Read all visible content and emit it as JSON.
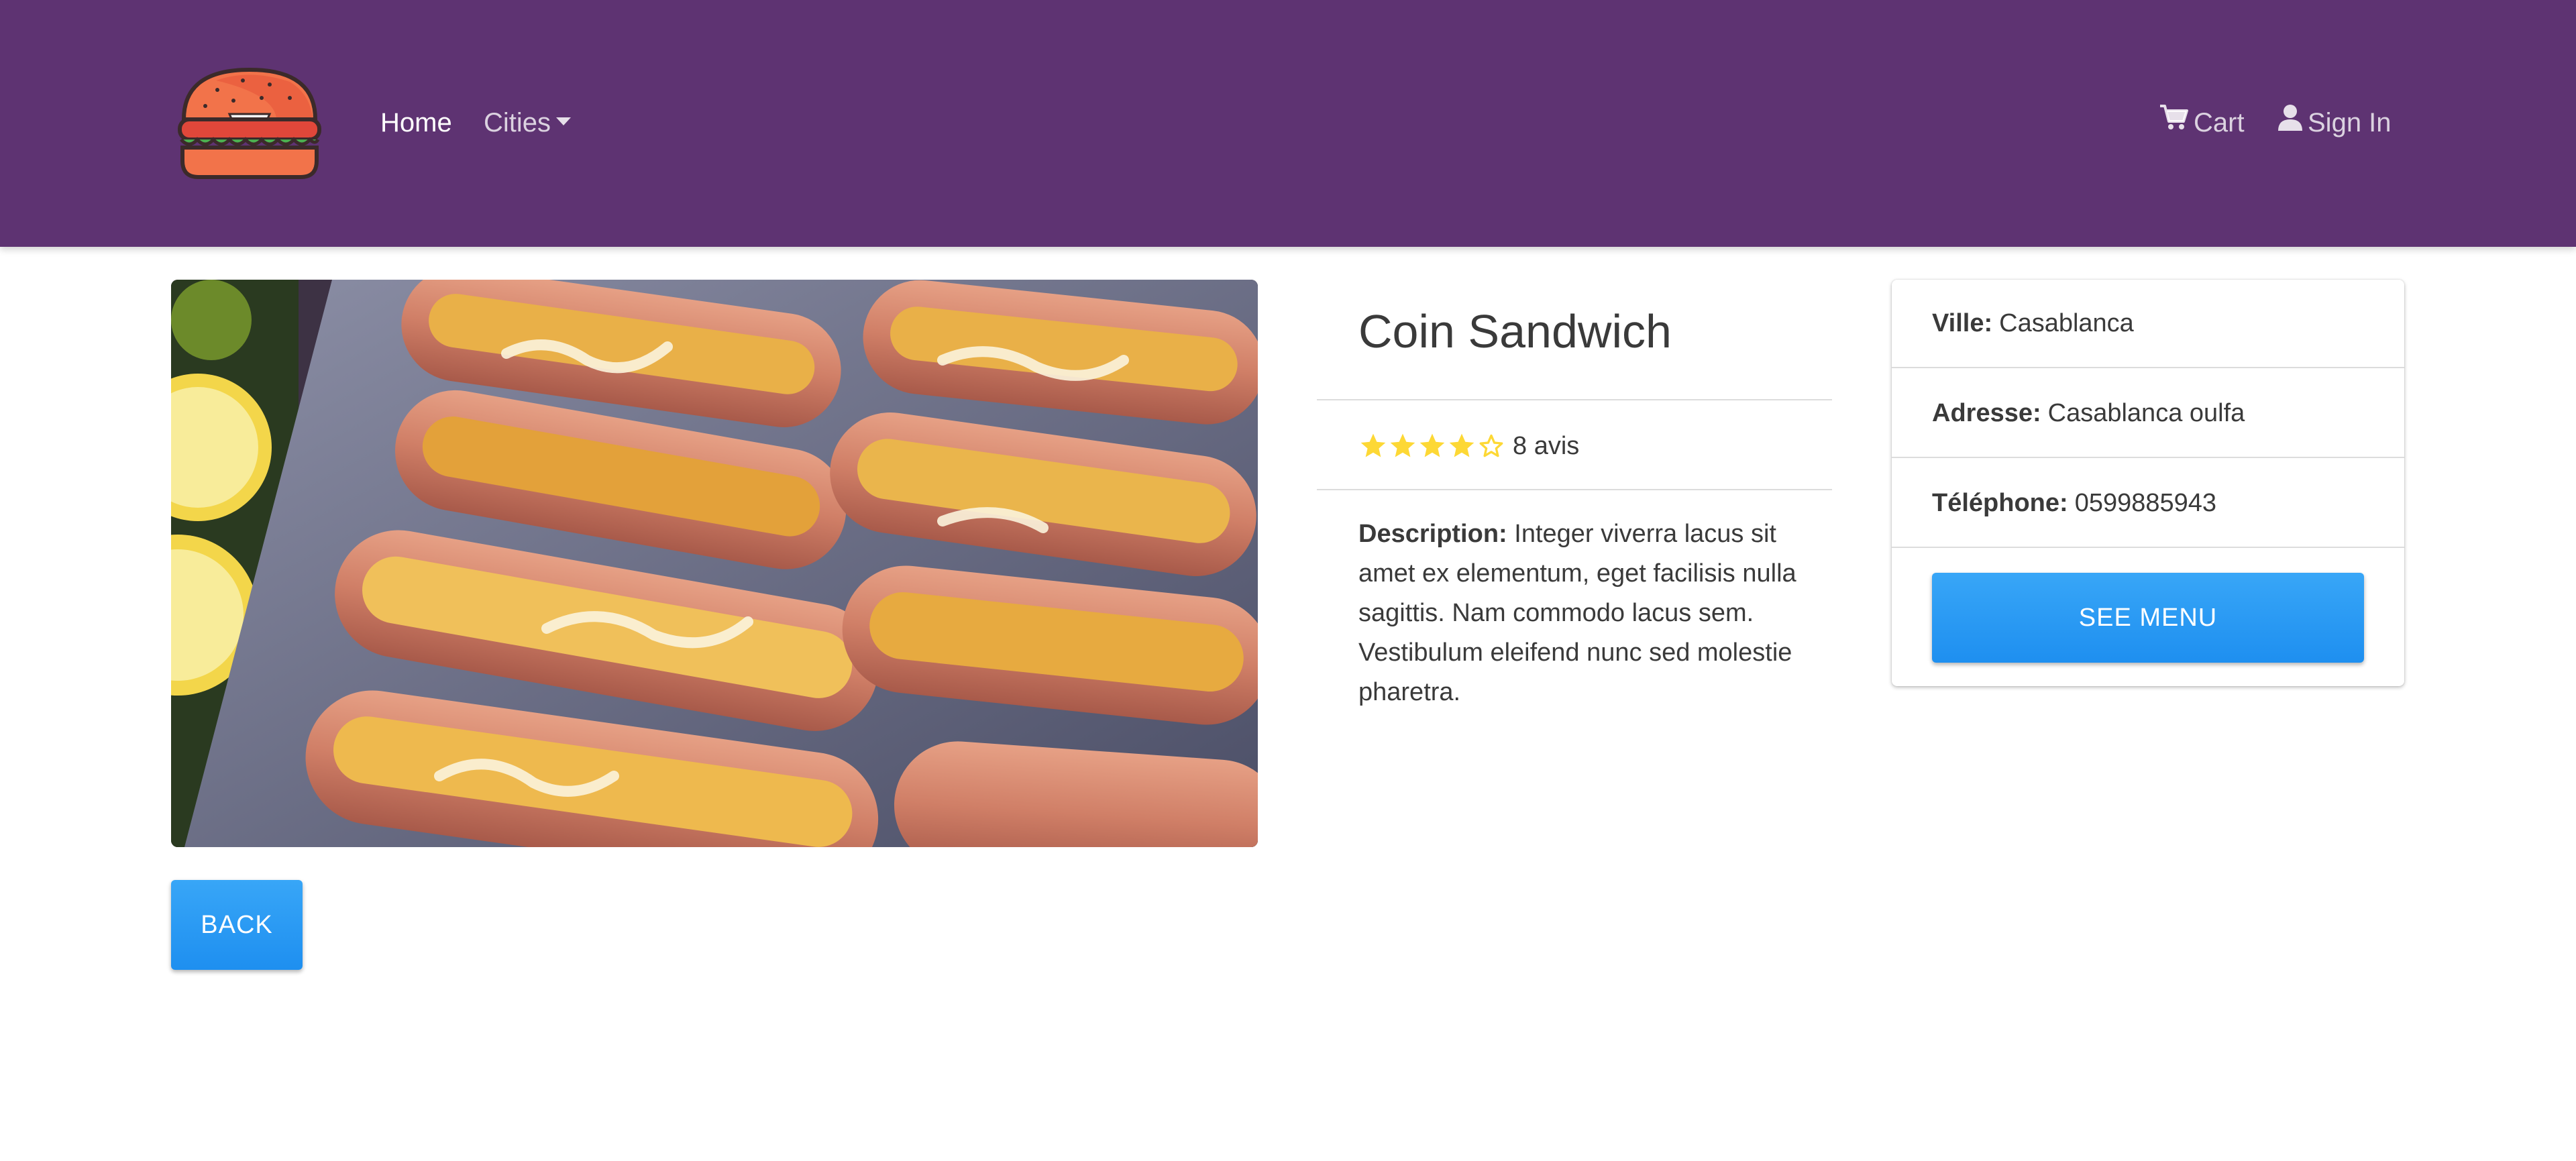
{
  "navbar": {
    "logo_icon": "burger-logo-icon",
    "home_label": "Home",
    "cities_label": "Cities",
    "cart_label": "Cart",
    "cart_icon": "shopping-cart-icon",
    "signin_label": "Sign In",
    "signin_icon": "user-icon",
    "background_color": "#5e3372"
  },
  "restaurant": {
    "image_icon": "food-photo",
    "name": "Coin Sandwich",
    "rating": 4,
    "rating_max": 5,
    "reviews_text": "8 avis",
    "description_label": "Description:",
    "description_text": "Integer viverra lacus sit amet ex elementum, eget facilisis nulla sagittis. Nam commodo lacus sem. Vestibulum eleifend nunc sed molestie pharetra."
  },
  "info": {
    "city_label": "Ville:",
    "city_value": "Casablanca",
    "address_label": "Adresse:",
    "address_value": "Casablanca oulfa",
    "phone_label": "Téléphone:",
    "phone_value": "0599885943",
    "see_menu_label": "SEE MENU"
  },
  "back_label": "BACK",
  "colors": {
    "button_blue": "#2196f3",
    "star_yellow": "#fdd835"
  }
}
